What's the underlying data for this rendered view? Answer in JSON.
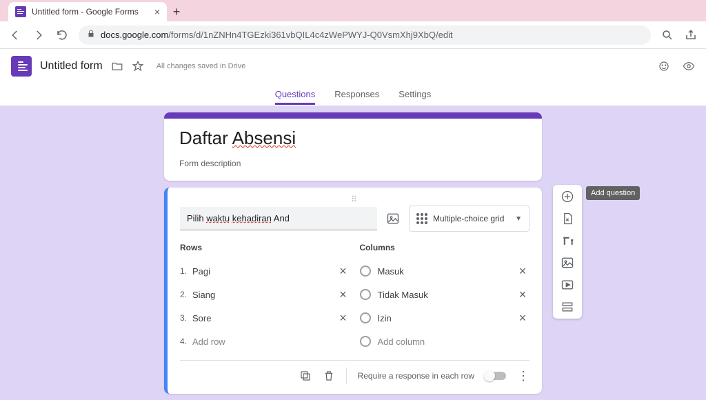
{
  "browser": {
    "tab_title": "Untitled form - Google Forms",
    "url_host": "docs.google.com",
    "url_path": "/forms/d/1nZNHn4TGEzki361vbQIL4c4zWePWYJ-Q0VsmXhj9XbQ/edit"
  },
  "header": {
    "doc_title": "Untitled form",
    "save_status": "All changes saved in Drive"
  },
  "tabs": {
    "questions": "Questions",
    "responses": "Responses",
    "settings": "Settings"
  },
  "form": {
    "title_plain": "Daftar ",
    "title_flagged": "Absensi",
    "description": "Form description"
  },
  "question": {
    "title_pre": "Pilih ",
    "title_mid1": "waktu",
    "title_sp1": " ",
    "title_mid2": "kehadiran",
    "title_post": " And",
    "type_label": "Multiple-choice grid",
    "rows_header": "Rows",
    "cols_header": "Columns",
    "rows": [
      {
        "n": "1.",
        "label": "Pagi"
      },
      {
        "n": "2.",
        "label": "Siang"
      },
      {
        "n": "3.",
        "label": "Sore"
      }
    ],
    "row_add_n": "4.",
    "row_add": "Add row",
    "cols": [
      {
        "label": "Masuk"
      },
      {
        "label": "Tidak Masuk"
      },
      {
        "label": "Izin"
      }
    ],
    "col_add": "Add column",
    "require_label": "Require a response in each row"
  },
  "tooltip": {
    "add_question": "Add question"
  }
}
